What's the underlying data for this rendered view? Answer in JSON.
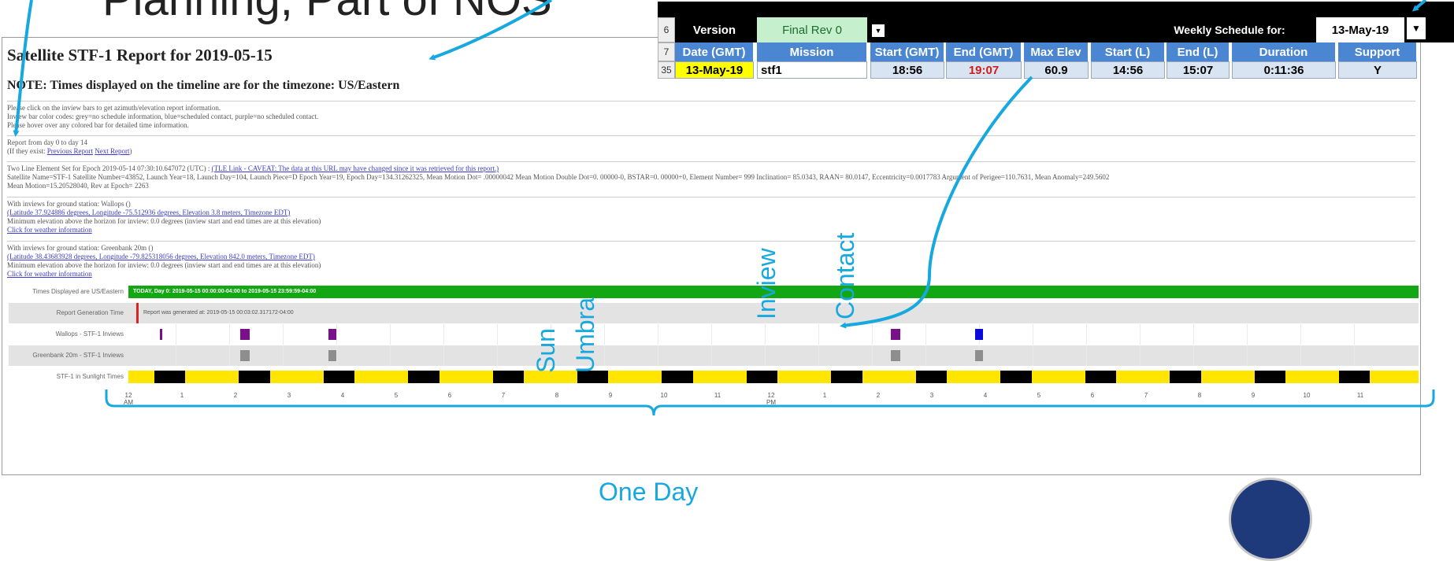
{
  "slide_title": "Planning, Part of NOS",
  "report": {
    "title": "Satellite STF-1 Report for 2019-05-15",
    "note": "NOTE: Times displayed on the timeline are for the timezone: US/Eastern",
    "instructions": [
      "Please click on the inview bars to get azimuth/elevation report information.",
      "Inview bar color codes: grey=no schedule information, blue=scheduled contact, purple=no scheduled contact.",
      "Please hover over any colored bar for detailed time information."
    ],
    "range": {
      "line": "Report from day 0 to day 14",
      "exist": "(If they exist:",
      "prev": "Previous Report",
      "next": "Next Report",
      "close": ")"
    },
    "tle": {
      "epoch": "Two Line Element Set for Epoch 2019-05-14 07:30:10.647072 (UTC) :",
      "link": "(TLE Link - CAVEAT: The data at this URL may have changed since it was retrieved for this report.)",
      "line2": "Satellite Name=STF-1 Satellite Number=43852, Launch Year=18, Launch Day=104, Launch Piece=D Epoch Year=19, Epoch Day=134.31262325, Mean Motion Dot= .00000042 Mean Motion Double Dot=0. 00000-0, BSTAR=0. 00000+0, Element Number= 999 Inclination= 85.0343, RAAN= 80.0147, Eccentricity=0.0017783 Argument of Perigee=110.7631, Mean Anomaly=249.5602",
      "line3": "Mean Motion=15.20528040, Rev at Epoch= 2263"
    },
    "wallops": {
      "title": "With inviews for ground station: Wallops ()",
      "coords": "(Latitude 37.924886 degrees, Longitude -75.512936 degrees, Elevation 3.8 meters, Timezone EDT)",
      "min_elev": "Minimum elevation above the horizon for inview: 0.0 degrees (inview start and end times are at this elevation)",
      "weather": "Click for weather information"
    },
    "greenbank": {
      "title": "With inviews for ground station: Greenbank 20m ()",
      "coords": "(Latitude 38.43683928 degrees, Longitude -79.825318056 degrees, Elevation 842.0 meters, Timezone EDT)",
      "min_elev": "Minimum elevation above the horizon for inview: 0.0 degrees (inview start and end times are at this elevation)",
      "weather": "Click for weather information"
    },
    "timeline": {
      "rows": [
        {
          "label": "Times Displayed are US/Eastern",
          "text": "TODAY, Day 0: 2019-05-15 00:00:00-04:00 to 2019-05-15 23:59:59-04:00"
        },
        {
          "label": "Report Generation Time",
          "text": "Report was generated at: 2019-05-15 00:03:02.317172-04:00"
        },
        {
          "label": "Wallops - STF-1 Inviews"
        },
        {
          "label": "Greenbank 20m - STF-1 Inviews"
        },
        {
          "label": "STF-1 in Sunlight Times"
        }
      ],
      "hours": [
        "12\nAM",
        "1",
        "2",
        "3",
        "4",
        "5",
        "6",
        "7",
        "8",
        "9",
        "10",
        "11",
        "12\nPM",
        "1",
        "2",
        "3",
        "4",
        "5",
        "6",
        "7",
        "8",
        "9",
        "10",
        "11"
      ],
      "colors": {
        "purple": "#7a0f8a",
        "blue": "#0a0adc",
        "grey": "#8e8e8e",
        "sun": "#ffe500",
        "umbra": "#000000"
      }
    }
  },
  "schedule": {
    "row6_num": "6",
    "version_label": "Version",
    "version_value": "Final Rev 0",
    "weekly_label": "Weekly Schedule for:",
    "weekly_value": "13-May-19",
    "row7_num": "7",
    "headers": [
      "Date (GMT)",
      "Mission",
      "Start (GMT)",
      "End (GMT)",
      "Max Elev",
      "Start (L)",
      "End (L)",
      "Duration",
      "Support"
    ],
    "row35_num": "35",
    "row": [
      "13-May-19",
      "stf1",
      "18:56",
      "19:07",
      "60.9",
      "14:56",
      "15:07",
      "0:11:36",
      "Y"
    ]
  },
  "annotations": {
    "sun": "Sun",
    "umbra": "Umbra",
    "inview": "Inview",
    "contact": "Contact",
    "one_day": "One Day"
  }
}
